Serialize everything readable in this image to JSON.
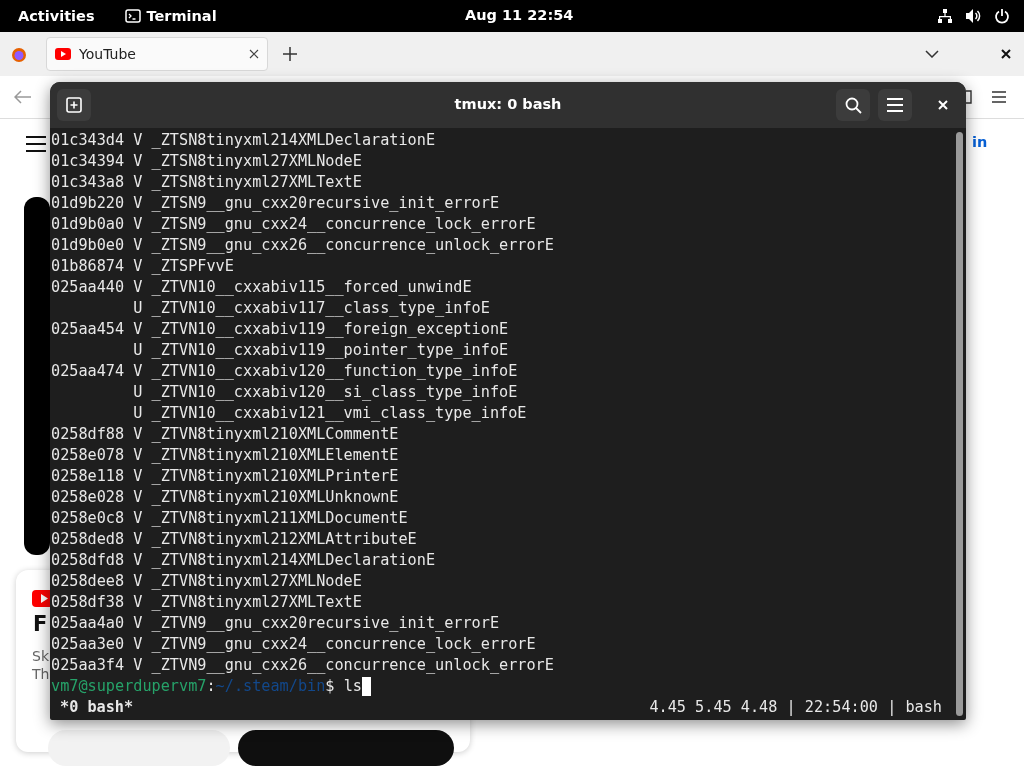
{
  "top_bar": {
    "activities": "Activities",
    "app": "Terminal",
    "clock": "Aug 11  22:54"
  },
  "browser": {
    "tabs": [
      {
        "title": "YouTube",
        "selected": true
      }
    ],
    "page": {
      "sign_in": "in",
      "promo": {
        "title": "F",
        "line_1": "Sk",
        "line_2": "Th"
      }
    }
  },
  "terminal": {
    "title": "tmux: 0 bash",
    "lines": [
      "01c343d4 V _ZTSN8tinyxml214XMLDeclarationE",
      "01c34394 V _ZTSN8tinyxml27XMLNodeE",
      "01c343a8 V _ZTSN8tinyxml27XMLTextE",
      "01d9b220 V _ZTSN9__gnu_cxx20recursive_init_errorE",
      "01d9b0a0 V _ZTSN9__gnu_cxx24__concurrence_lock_errorE",
      "01d9b0e0 V _ZTSN9__gnu_cxx26__concurrence_unlock_errorE",
      "01b86874 V _ZTSPFvvE",
      "025aa440 V _ZTVN10__cxxabiv115__forced_unwindE",
      "         U _ZTVN10__cxxabiv117__class_type_infoE",
      "025aa454 V _ZTVN10__cxxabiv119__foreign_exceptionE",
      "         U _ZTVN10__cxxabiv119__pointer_type_infoE",
      "025aa474 V _ZTVN10__cxxabiv120__function_type_infoE",
      "         U _ZTVN10__cxxabiv120__si_class_type_infoE",
      "         U _ZTVN10__cxxabiv121__vmi_class_type_infoE",
      "0258df88 V _ZTVN8tinyxml210XMLCommentE",
      "0258e078 V _ZTVN8tinyxml210XMLElementE",
      "0258e118 V _ZTVN8tinyxml210XMLPrinterE",
      "0258e028 V _ZTVN8tinyxml210XMLUnknownE",
      "0258e0c8 V _ZTVN8tinyxml211XMLDocumentE",
      "0258ded8 V _ZTVN8tinyxml212XMLAttributeE",
      "0258dfd8 V _ZTVN8tinyxml214XMLDeclarationE",
      "0258dee8 V _ZTVN8tinyxml27XMLNodeE",
      "0258df38 V _ZTVN8tinyxml27XMLTextE",
      "025aa4a0 V _ZTVN9__gnu_cxx20recursive_init_errorE",
      "025aa3e0 V _ZTVN9__gnu_cxx24__concurrence_lock_errorE",
      "025aa3f4 V _ZTVN9__gnu_cxx26__concurrence_unlock_errorE"
    ],
    "prompt": {
      "user_host": "vm7@superdupervm7",
      "separator": ":",
      "path": "~/.steam/bin",
      "command": "$ ls"
    },
    "status_bar": {
      "window": "*0 bash*",
      "info": "4.45 5.45 4.48 | 22:54:00 | bash"
    }
  }
}
